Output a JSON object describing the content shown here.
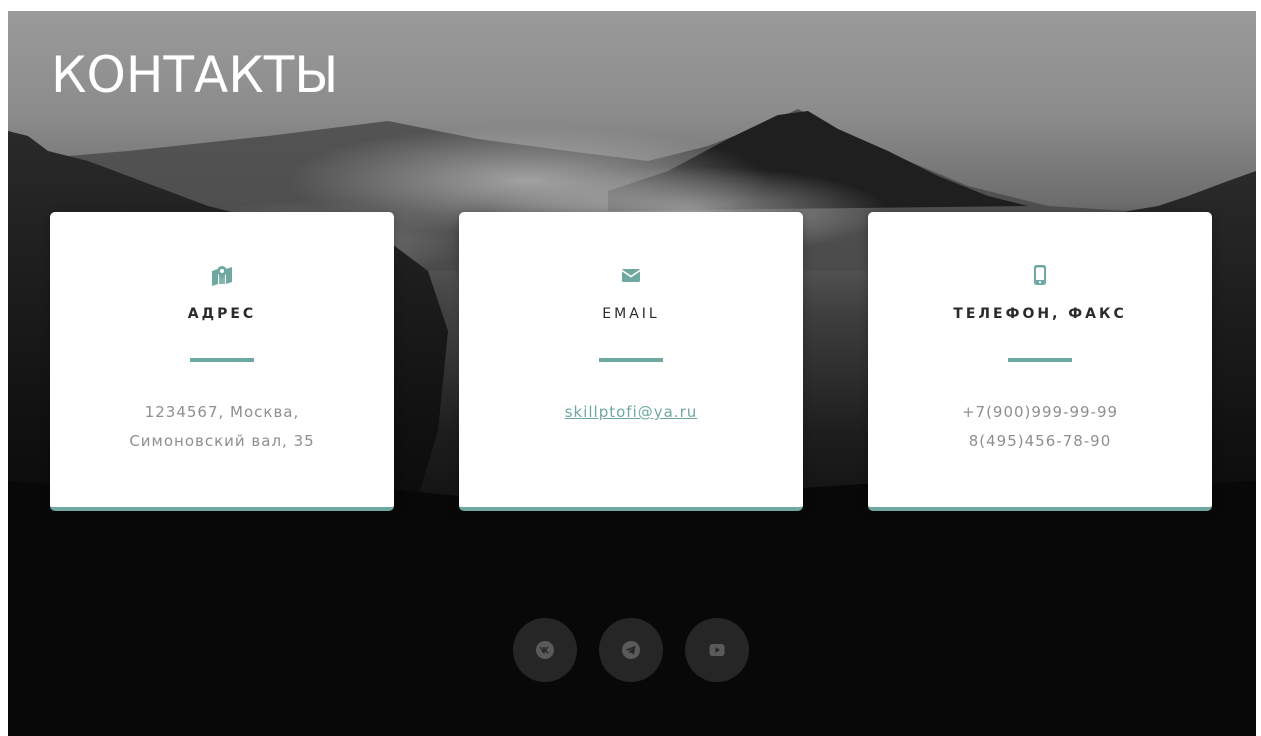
{
  "page": {
    "title": "КОНТАКТЫ"
  },
  "cards": [
    {
      "icon": "map-marker-icon",
      "title": "АДРЕС",
      "lines": [
        "1234567, Москва,",
        "Симоновский вал, 35"
      ]
    },
    {
      "icon": "envelope-icon",
      "title": "EMAIL",
      "link": "skillptofi@ya.ru"
    },
    {
      "icon": "mobile-phone-icon",
      "title": "ТЕЛЕФОН, ФАКС",
      "lines": [
        "+7(900)999-99-99",
        "8(495)456-78-90"
      ]
    }
  ],
  "social": [
    {
      "icon": "vk-icon"
    },
    {
      "icon": "telegram-icon"
    },
    {
      "icon": "youtube-icon"
    }
  ],
  "colors": {
    "accent": "#6fa8a1",
    "card_background": "#ffffff",
    "title_text": "#2b2b2b",
    "body_text": "#8f8f8f",
    "social_button": "#262626",
    "social_icon": "#5a5a5a"
  }
}
